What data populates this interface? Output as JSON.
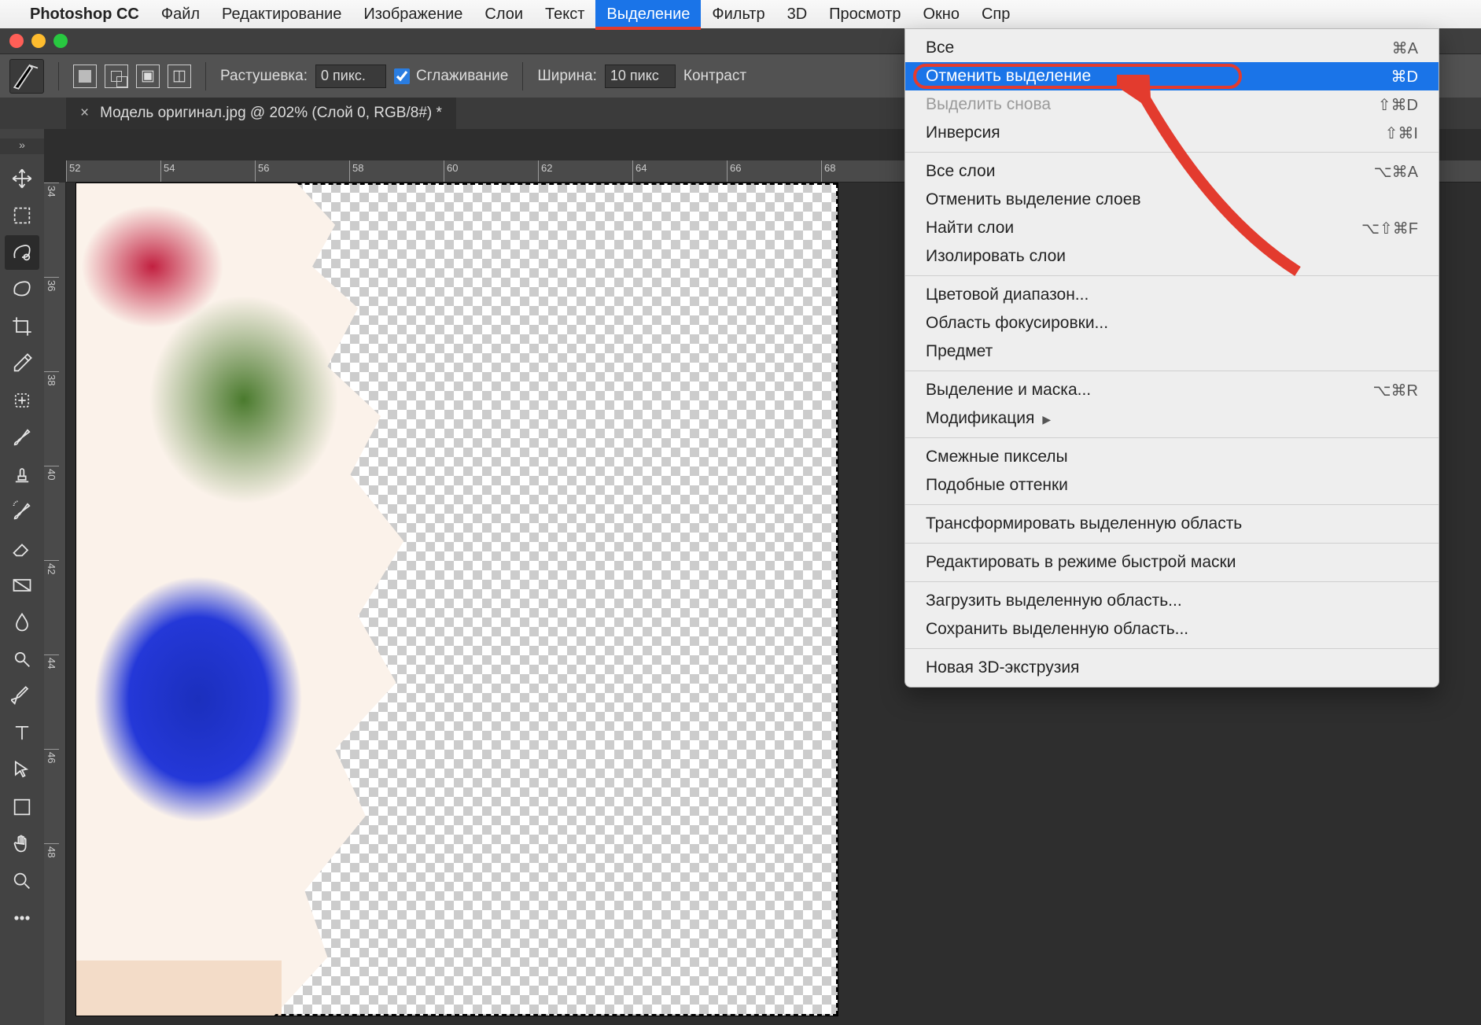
{
  "menubar": {
    "app": "Photoshop CC",
    "items": [
      "Файл",
      "Редактирование",
      "Изображение",
      "Слои",
      "Текст",
      "Выделение",
      "Фильтр",
      "3D",
      "Просмотр",
      "Окно",
      "Спр"
    ],
    "active_index": 5
  },
  "options": {
    "feather_label": "Растушевка:",
    "feather_value": "0 пикс.",
    "antialias_label": "Сглаживание",
    "antialias_checked": true,
    "width_label": "Ширина:",
    "width_value": "10 пикс",
    "contrast_label": "Контраст"
  },
  "tab": {
    "title": "Модель оригинал.jpg @ 202% (Слой 0, RGB/8#) *"
  },
  "ruler_h": [
    "52",
    "54",
    "56",
    "58",
    "60",
    "62",
    "64",
    "66",
    "68"
  ],
  "ruler_v": [
    "34",
    "36",
    "38",
    "40",
    "42",
    "44",
    "46",
    "48"
  ],
  "menu": {
    "groups": [
      [
        {
          "label": "Все",
          "shortcut": "⌘A"
        },
        {
          "label": "Отменить выделение",
          "shortcut": "⌘D",
          "highlight": true
        },
        {
          "label": "Выделить снова",
          "shortcut": "⇧⌘D",
          "disabled": true
        },
        {
          "label": "Инверсия",
          "shortcut": "⇧⌘I"
        }
      ],
      [
        {
          "label": "Все слои",
          "shortcut": "⌥⌘A"
        },
        {
          "label": "Отменить выделение слоев"
        },
        {
          "label": "Найти слои",
          "shortcut": "⌥⇧⌘F"
        },
        {
          "label": "Изолировать слои"
        }
      ],
      [
        {
          "label": "Цветовой диапазон..."
        },
        {
          "label": "Область фокусировки..."
        },
        {
          "label": "Предмет"
        }
      ],
      [
        {
          "label": "Выделение и маска...",
          "shortcut": "⌥⌘R"
        },
        {
          "label": "Модификация",
          "submenu": true
        }
      ],
      [
        {
          "label": "Смежные пикселы"
        },
        {
          "label": "Подобные оттенки"
        }
      ],
      [
        {
          "label": "Трансформировать выделенную область"
        }
      ],
      [
        {
          "label": "Редактировать в режиме быстрой маски"
        }
      ],
      [
        {
          "label": "Загрузить выделенную область..."
        },
        {
          "label": "Сохранить выделенную область..."
        }
      ],
      [
        {
          "label": "Новая 3D-экструзия"
        }
      ]
    ]
  },
  "tools": [
    "move",
    "marquee",
    "magnetic-lasso",
    "lasso",
    "crop",
    "eyedropper",
    "heal",
    "brush",
    "stamp",
    "history-brush",
    "eraser",
    "gradient",
    "blur",
    "dodge",
    "pen",
    "type",
    "path-select",
    "shape",
    "hand",
    "zoom",
    "more"
  ]
}
